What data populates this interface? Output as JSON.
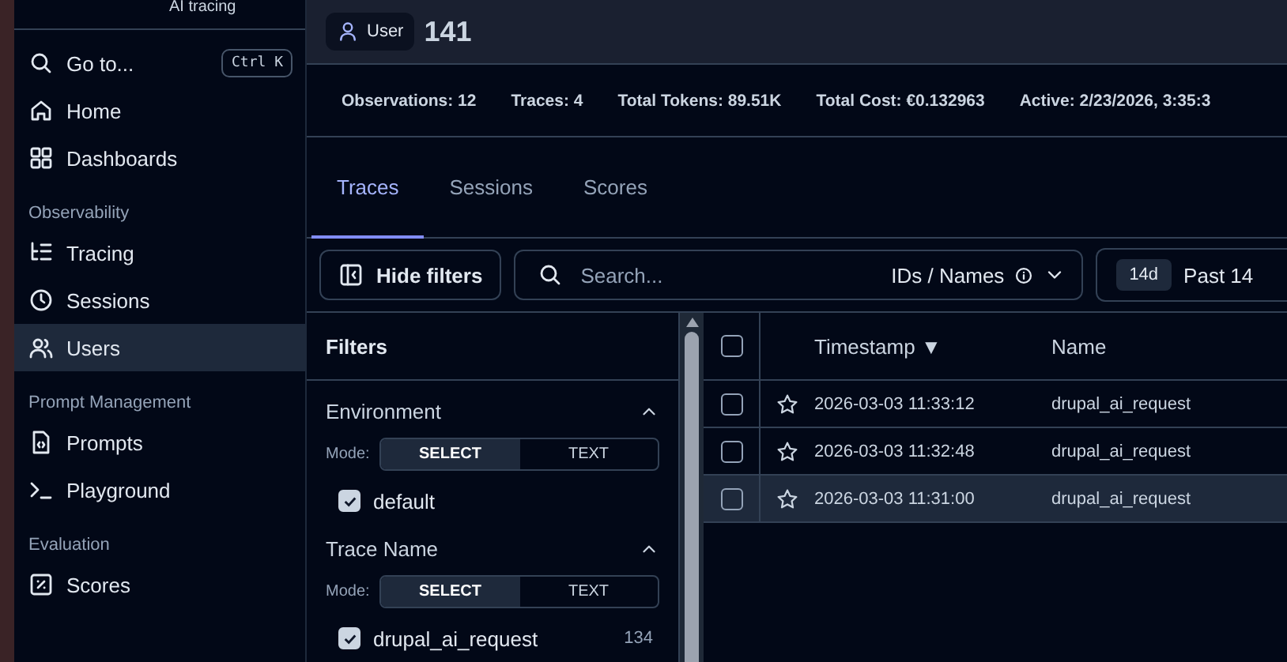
{
  "sidebar": {
    "brand_caption": "AI tracing",
    "search": {
      "label": "Go to...",
      "shortcut": "Ctrl K"
    },
    "sections": [
      {
        "items": [
          {
            "label": "Home",
            "selected": false
          },
          {
            "label": "Dashboards",
            "selected": false
          }
        ]
      },
      {
        "title": "Observability",
        "items": [
          {
            "label": "Tracing",
            "selected": false
          },
          {
            "label": "Sessions",
            "selected": false
          },
          {
            "label": "Users",
            "selected": true
          }
        ]
      },
      {
        "title": "Prompt Management",
        "items": [
          {
            "label": "Prompts",
            "selected": false
          },
          {
            "label": "Playground",
            "selected": false
          }
        ]
      },
      {
        "title": "Evaluation",
        "items": [
          {
            "label": "Scores",
            "selected": false
          }
        ]
      }
    ]
  },
  "header": {
    "badge": "User",
    "title": "141"
  },
  "stats": [
    "Observations: 12",
    "Traces: 4",
    "Total Tokens: 89.51K",
    "Total Cost: €0.132963",
    "Active: 2/23/2026, 3:35:3"
  ],
  "tabs": [
    {
      "label": "Traces",
      "selected": true
    },
    {
      "label": "Sessions",
      "selected": false
    },
    {
      "label": "Scores",
      "selected": false
    }
  ],
  "toolbar": {
    "hide_filters": "Hide filters",
    "search": {
      "placeholder": "Search..."
    },
    "search_mode": "IDs / Names",
    "range_badge": "14d",
    "range_label": "Past 14"
  },
  "filters": {
    "title": "Filters",
    "groups": [
      {
        "name": "Environment",
        "expanded": true,
        "mode_label": "Mode:",
        "modes": [
          {
            "label": "SELECT",
            "selected": true
          },
          {
            "label": "TEXT",
            "selected": false
          }
        ],
        "options": [
          {
            "label": "default",
            "checked": true
          }
        ]
      },
      {
        "name": "Trace Name",
        "expanded": true,
        "mode_label": "Mode:",
        "modes": [
          {
            "label": "SELECT",
            "selected": true
          },
          {
            "label": "TEXT",
            "selected": false
          }
        ],
        "options": [
          {
            "label": "drupal_ai_request",
            "count": "134",
            "checked": true
          }
        ]
      }
    ]
  },
  "table": {
    "all_checked": false,
    "columns": [
      {
        "label": "Timestamp",
        "sort": "▼"
      },
      {
        "label": "Name"
      }
    ],
    "rows": [
      {
        "timestamp": "2026-03-03 11:33:12",
        "name": "drupal_ai_request",
        "checked": false,
        "starred": false,
        "selected": false
      },
      {
        "timestamp": "2026-03-03 11:32:48",
        "name": "drupal_ai_request",
        "checked": false,
        "starred": false,
        "selected": false
      },
      {
        "timestamp": "2026-03-03 11:31:00",
        "name": "drupal_ai_request",
        "checked": false,
        "starred": false,
        "selected": true
      }
    ]
  }
}
